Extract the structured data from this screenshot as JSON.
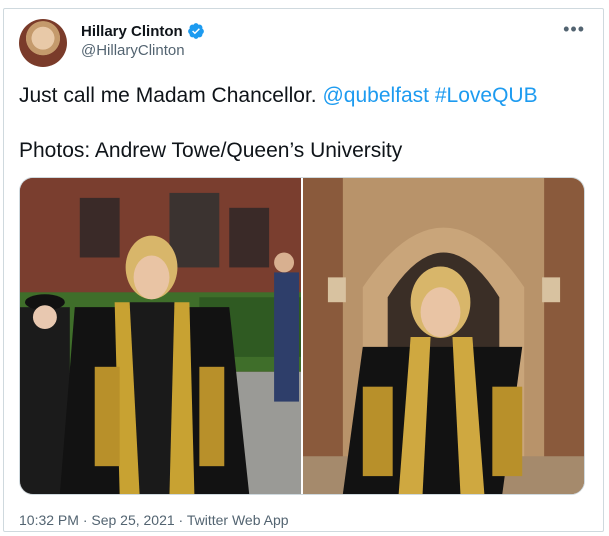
{
  "tweet": {
    "author_name": "Hillary Clinton",
    "author_handle": "@HillaryClinton",
    "verified_icon": "verified-badge-icon",
    "more_icon": "more-options-icon",
    "line1_text": "Just call me Madam Chancellor.",
    "mention": "@qubelfast",
    "hashtag": "#LoveQUB",
    "line2_text": "Photos: Andrew Towe/Queen’s University",
    "timestamp": "10:32 PM · Sep 25, 2021 · Twitter Web App",
    "link_color": "#1d9bf0"
  }
}
